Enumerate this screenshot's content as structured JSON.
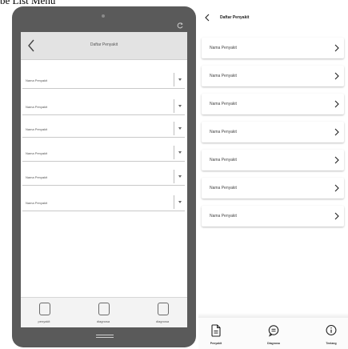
{
  "caption": "be List Menu",
  "left_screen": {
    "title": "Daftar Penyakit",
    "rows": [
      {
        "label": "Nama Penyakit"
      },
      {
        "label": "Nama Penyakit"
      },
      {
        "label": "Nama Penyakit"
      },
      {
        "label": "Nama Penyakit"
      },
      {
        "label": "Nama Penyakit"
      },
      {
        "label": "Nama Penyakit"
      }
    ],
    "nav": [
      {
        "label": "penyakit"
      },
      {
        "label": "diagnosa"
      },
      {
        "label": "diagnosa"
      }
    ]
  },
  "right_screen": {
    "title": "Daftar Penyakit",
    "rows": [
      {
        "label": "Nama Penyakit"
      },
      {
        "label": "Nama Penyakit"
      },
      {
        "label": "Nama Penyakit"
      },
      {
        "label": "Nama Penyakit"
      },
      {
        "label": "Nama Penyakit"
      },
      {
        "label": "Nama Penyakit"
      },
      {
        "label": "Nama Penyakit"
      }
    ],
    "nav": [
      {
        "label": "Penyakit",
        "icon": "document-icon"
      },
      {
        "label": "Diagnosa",
        "icon": "chat-icon"
      },
      {
        "label": "Tentang",
        "icon": "info-icon"
      }
    ]
  },
  "colors": {
    "phone_frame": "#5a5a5a",
    "header_gray": "#e3e3e3",
    "nav_gray": "#f3f3f3"
  }
}
